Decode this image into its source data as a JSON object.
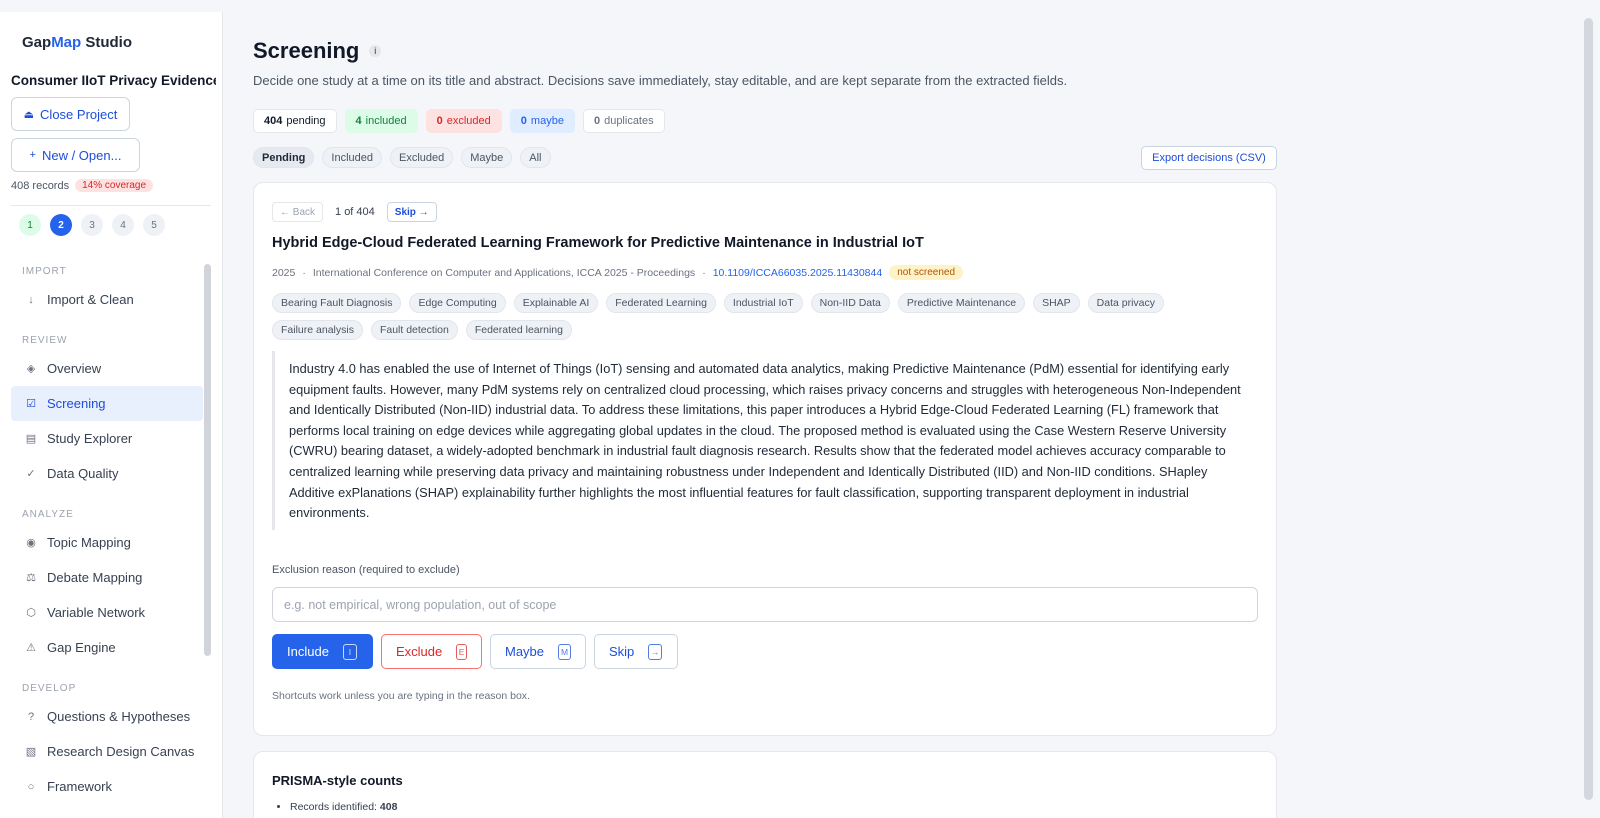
{
  "app": {
    "brand_prefix": "Gap",
    "brand_accent": "Map",
    "brand_suffix": " Studio",
    "project_name": "Consumer IIoT Privacy Evidence ...",
    "close_project": "Close Project",
    "new_open": "New / Open...",
    "records": "408 records",
    "coverage": "14% coverage",
    "steps": [
      "1",
      "2",
      "3",
      "4",
      "5"
    ]
  },
  "nav": {
    "import_section": "IMPORT",
    "import_clean": "Import & Clean",
    "review_section": "REVIEW",
    "overview": "Overview",
    "screening": "Screening",
    "study_explorer": "Study Explorer",
    "data_quality": "Data Quality",
    "analyze_section": "ANALYZE",
    "topic_mapping": "Topic Mapping",
    "debate_mapping": "Debate Mapping",
    "variable_network": "Variable Network",
    "gap_engine": "Gap Engine",
    "develop_section": "DEVELOP",
    "questions": "Questions & Hypotheses",
    "research_design": "Research Design Canvas",
    "framework": "Framework"
  },
  "page": {
    "title": "Screening",
    "subtitle": "Decide one study at a time on its title and abstract. Decisions save immediately, stay editable, and are kept separate from the extracted fields."
  },
  "counts": {
    "pending_n": "404",
    "pending_label": "pending",
    "included_n": "4",
    "included_label": "included",
    "excluded_n": "0",
    "excluded_label": "excluded",
    "maybe_n": "0",
    "maybe_label": "maybe",
    "duplicates_n": "0",
    "duplicates_label": "duplicates"
  },
  "filters": [
    "Pending",
    "Included",
    "Excluded",
    "Maybe",
    "All"
  ],
  "export_label": "Export decisions (CSV)",
  "study": {
    "back": "← Back",
    "position": "1 of 404",
    "skip": "Skip →",
    "title": "Hybrid Edge-Cloud Federated Learning Framework for Predictive Maintenance in Industrial IoT",
    "year": "2025",
    "venue": "International Conference on Computer and Applications, ICCA 2025 - Proceedings",
    "doi": "10.1109/ICCA66035.2025.11430844",
    "status": "not screened",
    "tags": [
      "Bearing Fault Diagnosis",
      "Edge Computing",
      "Explainable AI",
      "Federated Learning",
      "Industrial IoT",
      "Non-IID Data",
      "Predictive Maintenance",
      "SHAP",
      "Data privacy",
      "Failure analysis",
      "Fault detection",
      "Federated learning"
    ],
    "abstract": "Industry 4.0 has enabled the use of Internet of Things (IoT) sensing and automated data analytics, making Predictive Maintenance (PdM) essential for identifying early equipment faults. However, many PdM systems rely on centralized cloud processing, which raises privacy concerns and struggles with heterogeneous Non-Independent and Identically Distributed (Non-IID) industrial data. To address these limitations, this paper introduces a Hybrid Edge-Cloud Federated Learning (FL) framework that performs local training on edge devices while aggregating global updates in the cloud. The proposed method is evaluated using the Case Western Reserve University (CWRU) bearing dataset, a widely-adopted benchmark in industrial fault diagnosis research. Results show that the federated model achieves accuracy comparable to centralized learning while preserving data privacy and maintaining robustness under Independent and Identically Distributed (IID) and Non-IID conditions. SHapley Additive exPlanations (SHAP) explainability further highlights the most influential features for fault classification, supporting transparent deployment in industrial environments."
  },
  "decision": {
    "reason_label": "Exclusion reason (required to exclude)",
    "reason_placeholder": "e.g. not empirical, wrong population, out of scope",
    "reason_value": "",
    "include": "Include",
    "include_key": "I",
    "exclude": "Exclude",
    "exclude_key": "E",
    "maybe": "Maybe",
    "maybe_key": "M",
    "skip": "Skip",
    "skip_key": "→",
    "hint": "Shortcuts work unless you are typing in the reason box."
  },
  "prisma": {
    "title": "PRISMA-style counts",
    "identified_label": "Records identified: ",
    "identified_value": "408"
  }
}
